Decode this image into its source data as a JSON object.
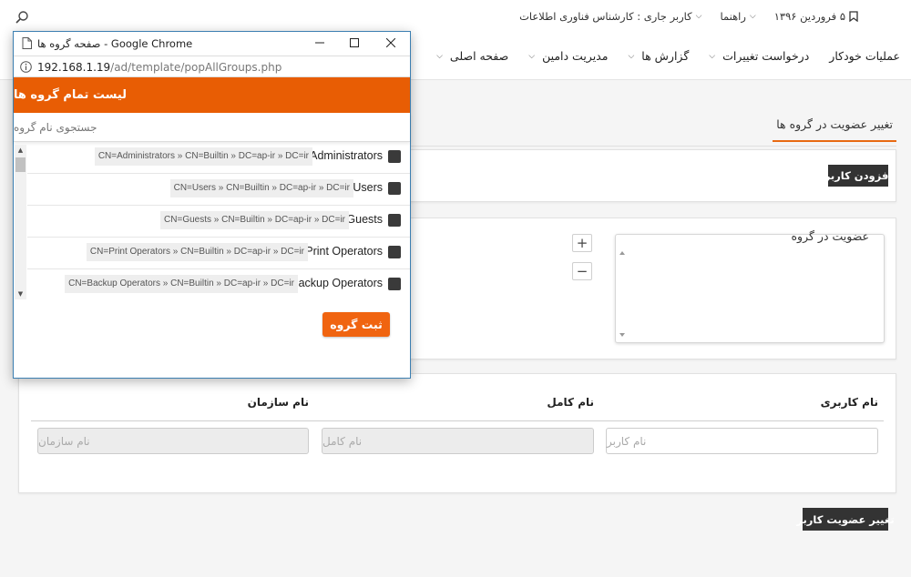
{
  "header": {
    "current_user": "کاربر جاری : کارشناس فناوری اطلاعات",
    "help": "راهنما",
    "date": "۵ فروردین ۱۳۹۶",
    "nav": [
      "صفحه اصلی",
      "مدیریت دامین",
      "گزارش ها",
      "درخواست تغییرات",
      "عملیات خودکار"
    ]
  },
  "page": {
    "tab_label": "تغییر عضویت در گروه ها",
    "add_user_button": "افزودن کاربر",
    "membership_label": "عضویت در گروه",
    "plus": "+",
    "minus": "−",
    "columns": {
      "username": "نام کاربری",
      "fullname": "نام کامل",
      "organization": "نام سازمان"
    },
    "inputs": {
      "username_placeholder": "نام کاربر",
      "fullname_placeholder": "نام کامل",
      "organization_placeholder": "نام سازمان"
    },
    "change_membership_button": "تغییر عضویت کاربر"
  },
  "popup": {
    "window_title": "صفحه گروه ها - Google Chrome",
    "url_host": "192.168.1.19",
    "url_path": "/ad/template/popAllGroups.php",
    "heading": "لیست تمام گروه ها",
    "search_placeholder": "جستجوی نام گروه",
    "groups": [
      {
        "name": "Administrators",
        "dn": "CN=Administrators » CN=Builtin » DC=ap-ir » DC=ir"
      },
      {
        "name": "Users",
        "dn": "CN=Users » CN=Builtin » DC=ap-ir » DC=ir"
      },
      {
        "name": "Guests",
        "dn": "CN=Guests » CN=Builtin » DC=ap-ir » DC=ir"
      },
      {
        "name": "Print Operators",
        "dn": "CN=Print Operators » CN=Builtin » DC=ap-ir » DC=ir"
      },
      {
        "name": "Backup Operators",
        "dn": "CN=Backup Operators » CN=Builtin » DC=ap-ir » DC=ir"
      }
    ],
    "submit_button": "ثبت گروه"
  },
  "colors": {
    "accent": "#e85d04",
    "button_dark": "#333333",
    "window_border": "#3c7fb1"
  }
}
